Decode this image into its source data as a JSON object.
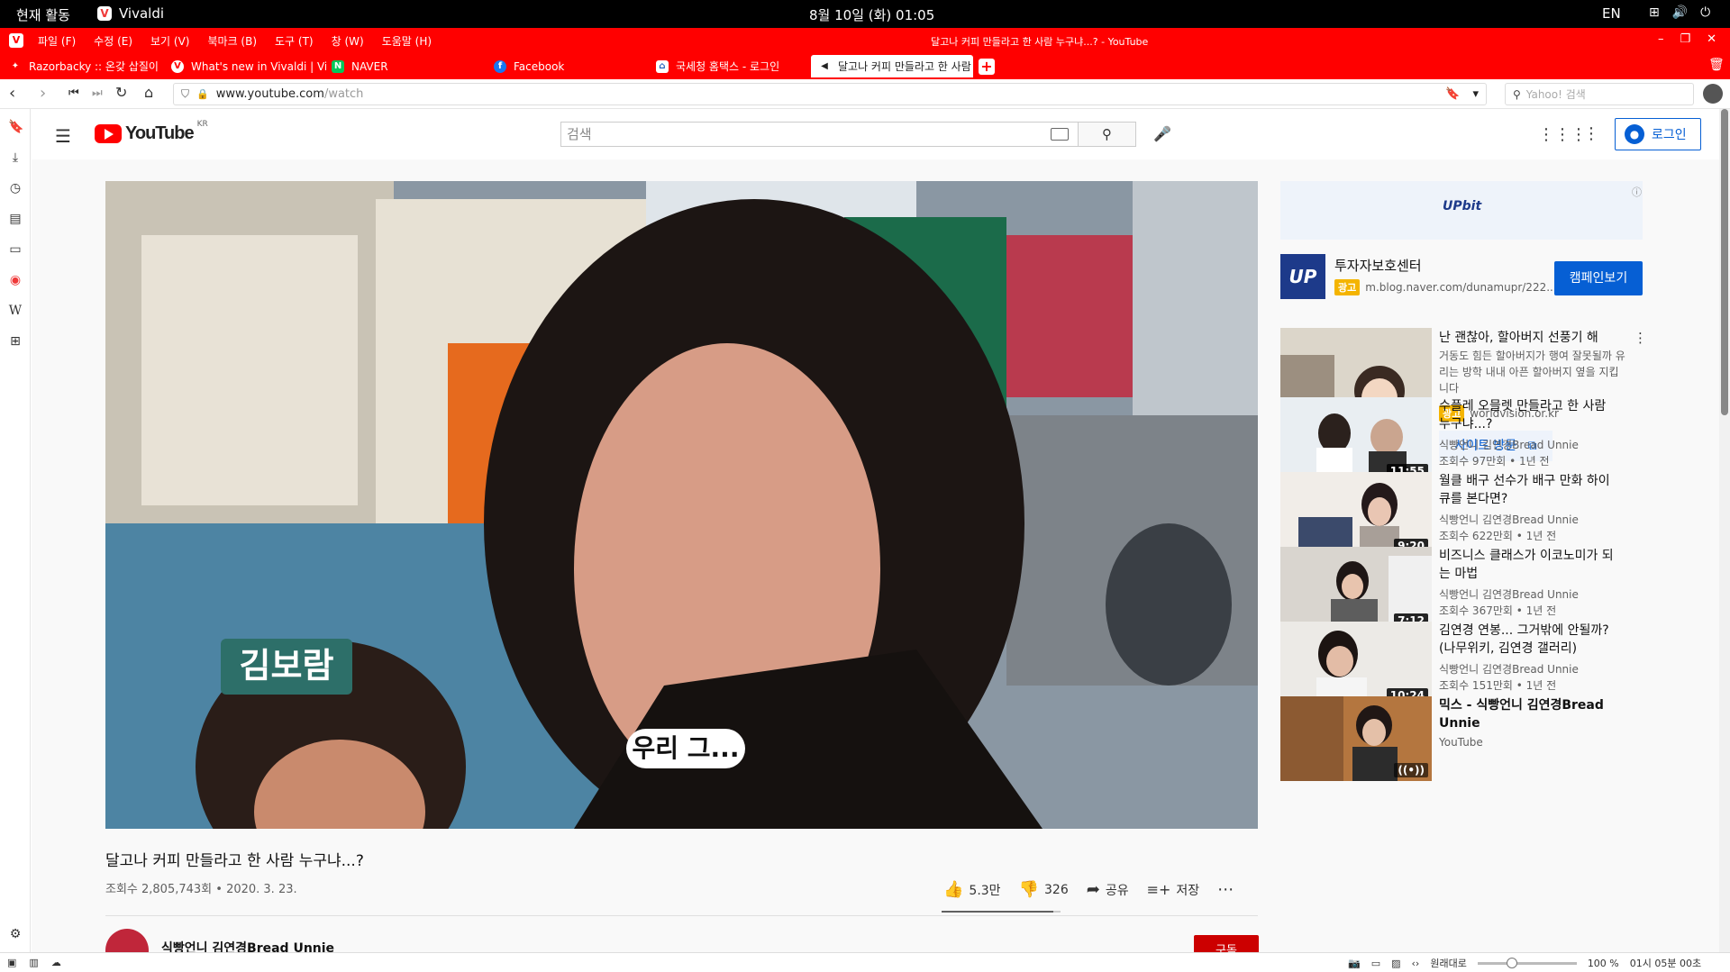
{
  "os_bar": {
    "activities": "현재 활동",
    "app_name": "Vivaldi",
    "clock": "8월 10일 (화)  01:05",
    "lang": "EN"
  },
  "menubar": {
    "items": [
      "파일 (F)",
      "수정 (E)",
      "보기 (V)",
      "북마크 (B)",
      "도구 (T)",
      "창 (W)",
      "도움말 (H)"
    ],
    "window_title": "달고나 커피 만들라고 한 사람 누구냐...? - YouTube"
  },
  "tabs": [
    {
      "label": "Razorbacky :: 온갖 삽질이 기",
      "favicon": "razorbacky-icon",
      "color": "#ff0000"
    },
    {
      "label": "What's new in Vivaldi | Viva",
      "favicon": "vivaldi-icon",
      "color": "#ff0000"
    },
    {
      "label": "NAVER",
      "favicon": "naver-icon",
      "color": "#03c75a"
    },
    {
      "label": "Facebook",
      "favicon": "facebook-icon",
      "color": "#1877f2"
    },
    {
      "label": "국세청 홈택스 - 로그인",
      "favicon": "hometax-icon",
      "color": "#1d5cbc"
    },
    {
      "label": "달고나 커피 만들라고 한 사람",
      "favicon": "speaker-icon",
      "color": "#ffffff"
    }
  ],
  "address": {
    "domain": "www.youtube.com",
    "path": "/watch",
    "search_placeholder": "Yahoo! 검색"
  },
  "youtube": {
    "logo_text": "YouTube",
    "region": "KR",
    "search_placeholder": "검색",
    "login_label": "로그인"
  },
  "video": {
    "subtitle_name": "김보람",
    "subtitle_line": "우리 그...",
    "title": "달고나 커피 만들라고 한 사람 누구냐...?",
    "meta": "조회수 2,805,743회 • 2020. 3. 23.",
    "likes": "5.3만",
    "dislikes": "326",
    "like_ratio": 0.94,
    "share_label": "공유",
    "save_label": "저장",
    "channel_name": "식빵언니 김연경Bread Unnie",
    "subscribe_label": "구독"
  },
  "ad": {
    "banner_brand": "UPbit",
    "sponsor_title": "투자자보호센터",
    "sponsor_url": "m.blog.naver.com/dunamupr/222...",
    "badge": "광고",
    "campaign_label": "캠페인보기",
    "promo_title": "난 괜찮아, 할아버지 선풍기 해",
    "promo_desc": "거동도 힘든 할아버지가 행여 잘못될까 유리는 방학 내내 아픈 할아버지 옆을 지킵니다",
    "promo_source": "worldvision.or.kr",
    "visit_label": "사이트 방문"
  },
  "recommendations": [
    {
      "title": "수플레 오믈렛 만들라고 한 사람 누구냐...?",
      "channel": "식빵언니 김연경Bread Unnie",
      "stats": "조회수 97만회 • 1년 전",
      "duration": "11:55"
    },
    {
      "title": "월클 배구 선수가 배구 만화 하이큐를 본다면?",
      "channel": "식빵언니 김연경Bread Unnie",
      "stats": "조회수 622만회 • 1년 전",
      "duration": "9:20"
    },
    {
      "title": "비즈니스 클래스가 이코노미가 되는 마법",
      "channel": "식빵언니 김연경Bread Unnie",
      "stats": "조회수 367만회 • 1년 전",
      "duration": "7:12"
    },
    {
      "title": "김연경 연봉... 그거밖에 안될까? (나무위키, 김연경 갤러리)",
      "channel": "식빵언니 김연경Bread Unnie",
      "stats": "조회수 151만회 • 1년 전",
      "duration": "10:24"
    },
    {
      "title": "믹스 - 식빵언니 김연경Bread Unnie",
      "channel": "YouTube",
      "stats": "",
      "duration": ""
    }
  ],
  "statusbar": {
    "reset": "원래대로",
    "zoom": "100 %",
    "time": "01시 05분 00초"
  }
}
